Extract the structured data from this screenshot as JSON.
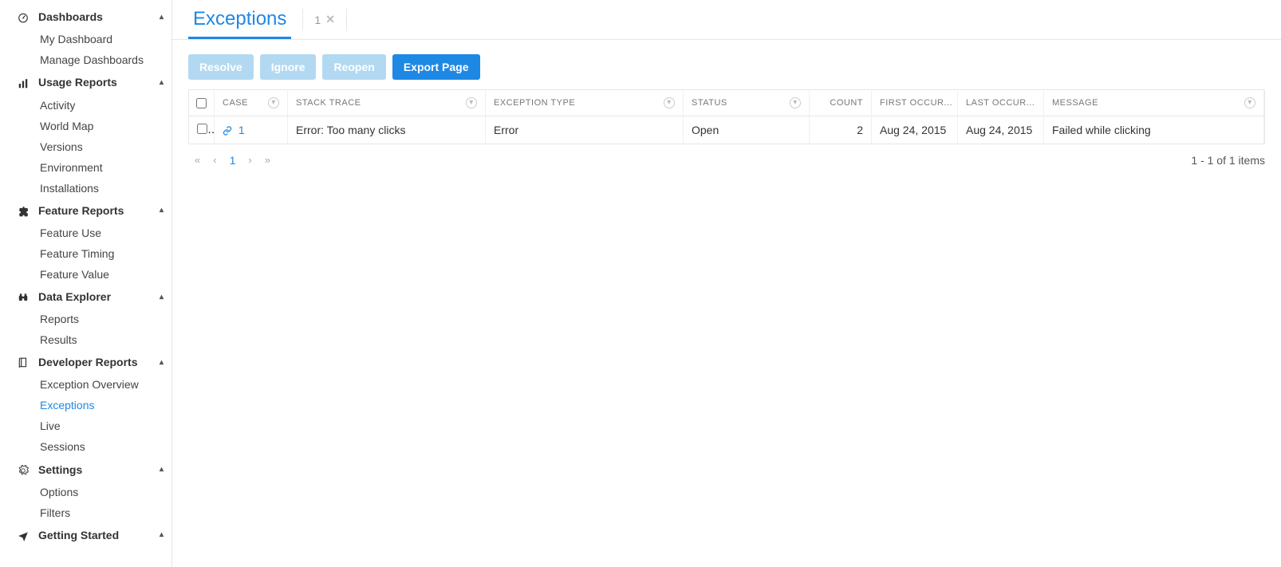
{
  "sidebar": {
    "sections": [
      {
        "icon": "dashboard",
        "label": "Dashboards",
        "items": [
          "My Dashboard",
          "Manage Dashboards"
        ],
        "active_index": -1
      },
      {
        "icon": "bar-chart",
        "label": "Usage Reports",
        "items": [
          "Activity",
          "World Map",
          "Versions",
          "Environment",
          "Installations"
        ],
        "active_index": -1
      },
      {
        "icon": "puzzle",
        "label": "Feature Reports",
        "items": [
          "Feature Use",
          "Feature Timing",
          "Feature Value"
        ],
        "active_index": -1
      },
      {
        "icon": "binoculars",
        "label": "Data Explorer",
        "items": [
          "Reports",
          "Results"
        ],
        "active_index": -1
      },
      {
        "icon": "book",
        "label": "Developer Reports",
        "items": [
          "Exception Overview",
          "Exceptions",
          "Live",
          "Sessions"
        ],
        "active_index": 1
      },
      {
        "icon": "gear",
        "label": "Settings",
        "items": [
          "Options",
          "Filters"
        ],
        "active_index": -1
      },
      {
        "icon": "plane",
        "label": "Getting Started",
        "items": [],
        "active_index": -1
      }
    ]
  },
  "header": {
    "title": "Exceptions",
    "tab_count": "1"
  },
  "toolbar": {
    "resolve": "Resolve",
    "ignore": "Ignore",
    "reopen": "Reopen",
    "export": "Export Page"
  },
  "table": {
    "headers": {
      "case": "CASE",
      "stack_trace": "STACK TRACE",
      "exception_type": "EXCEPTION TYPE",
      "status": "STATUS",
      "count": "COUNT",
      "first_occur": "FIRST OCCUR...",
      "last_occur": "LAST OCCUR...",
      "message": "MESSAGE"
    },
    "rows": [
      {
        "case_id": "1",
        "stack_trace": "Error: Too many clicks",
        "exception_type": "Error",
        "status": "Open",
        "count": "2",
        "first_occurrence": "Aug 24, 2015",
        "last_occurrence": "Aug 24, 2015",
        "message": "Failed while clicking"
      }
    ]
  },
  "pager": {
    "current": "1",
    "summary": "1 - 1 of 1 items"
  }
}
